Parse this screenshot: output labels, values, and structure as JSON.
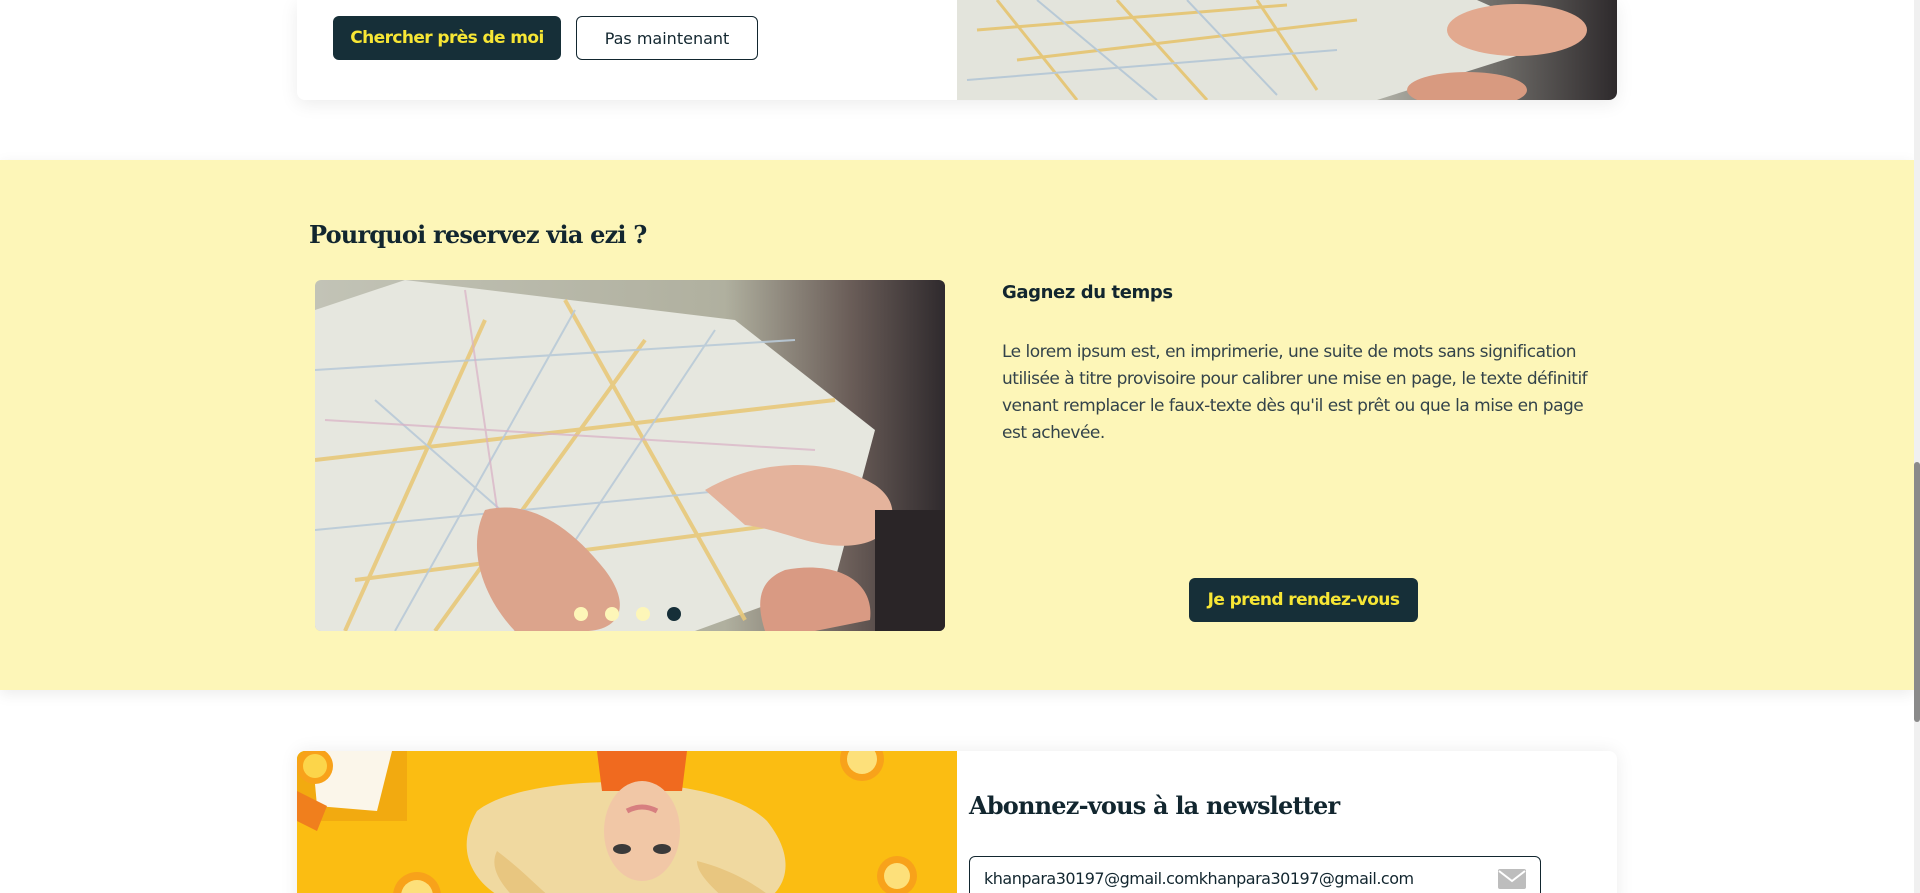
{
  "locate_card": {
    "search_button": "Chercher près de moi",
    "dismiss_button": "Pas maintenant"
  },
  "why_section": {
    "title": "Pourquoi reservez via ezi ?",
    "feature_title": "Gagnez du temps",
    "feature_text": "Le lorem ipsum est, en imprimerie, une suite de mots sans signification utilisée à titre provisoire pour calibrer une mise en page, le texte définitif venant remplacer le faux-texte dès qu'il est prêt ou que la mise en page est achevée.",
    "cta_button": "Je prend rendez-vous",
    "carousel": {
      "slide_count": 4,
      "active_slide": 4
    }
  },
  "newsletter": {
    "title": "Abonnez-vous à la newsletter",
    "email_value": "khanpara30197@gmail.comkhanpara30197@gmail.com",
    "icon": "mail-icon"
  },
  "colors": {
    "brand_dark": "#162f38",
    "brand_yellow": "#f7e635",
    "section_background": "#fdf6b8"
  }
}
